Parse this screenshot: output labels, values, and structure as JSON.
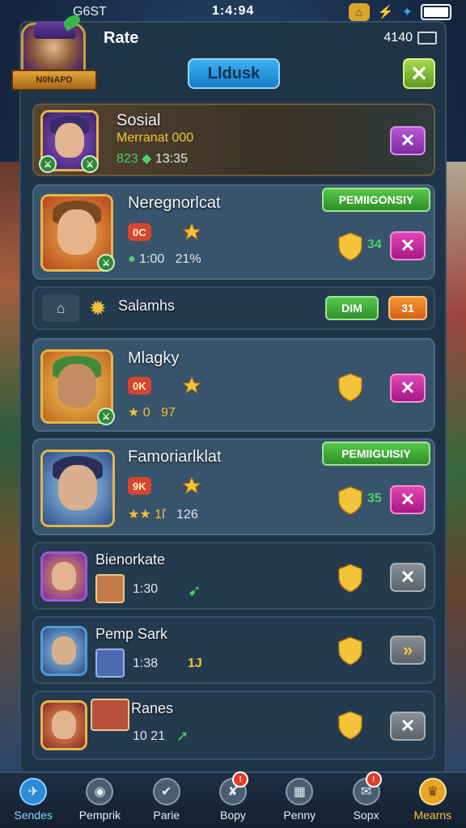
{
  "status_bar": {
    "carrier": "G6ST",
    "time": "1:4:94"
  },
  "header": {
    "title": "Rate",
    "right_text": "4140",
    "tab_label": "Lldusk",
    "close_symbol": "✕",
    "ribbon_text": "N0NAPD"
  },
  "rows": [
    {
      "name": "Sosial",
      "line2": "Merranat 000",
      "stat_a": "823",
      "stat_b": "13:35",
      "action": "✕"
    },
    {
      "name": "Neregnorlcat",
      "tag": "PEMIIGONSIY",
      "pill": "0C",
      "line2a": "1:00",
      "line2b": "21%",
      "score": "34",
      "action": "✕"
    },
    {
      "name": "Salamhs",
      "btn_a": "DIM",
      "btn_b": "31"
    },
    {
      "name": "Mlagky",
      "pill": "0K",
      "line2a": "0",
      "line2b": "97",
      "action": "✕"
    },
    {
      "name": "Famoriarlklat",
      "tag": "PEMIIGUISIY",
      "pill": "9K",
      "line2a": "1ľ",
      "line2b": "126",
      "score": "35",
      "action": "✕"
    },
    {
      "name": "Bienorkate",
      "time": "1:30",
      "action": "✕"
    },
    {
      "name": "Pemp Sark",
      "time": "1:38",
      "extra": "1J",
      "action": "»"
    },
    {
      "name": "Ranes",
      "time": "10 21",
      "action": "✕"
    }
  ],
  "bottom_nav": [
    {
      "label": "Sendes"
    },
    {
      "label": "Pemprik"
    },
    {
      "label": "Parie"
    },
    {
      "label": "Bopy"
    },
    {
      "label": "Penny"
    },
    {
      "label": "Sopx"
    },
    {
      "label": "Mearns"
    }
  ],
  "colors": {
    "gold": "#f3c33a",
    "green": "#49d06b",
    "panel": "#1f3447",
    "accent_blue": "#3bb3f2"
  }
}
